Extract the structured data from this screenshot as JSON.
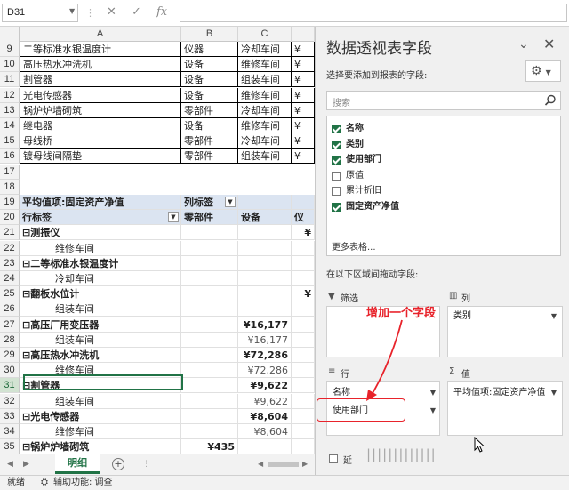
{
  "formula_bar": {
    "name_box": "D31",
    "icons": [
      "cancel-x-icon",
      "enter-check-icon",
      "fx-icon"
    ],
    "fx_label": "fx",
    "formula": ""
  },
  "sheet": {
    "columns": [
      "A",
      "B",
      "C"
    ],
    "selected_cell": "D31",
    "source_rows": [
      {
        "row": "9",
        "a": "二等标准水银温度计",
        "b": "仪器",
        "c": "冷却车间",
        "d": "¥"
      },
      {
        "row": "10",
        "a": "高压热水冲洗机",
        "b": "设备",
        "c": "维修车间",
        "d": "¥"
      },
      {
        "row": "11",
        "a": "割管器",
        "b": "设备",
        "c": "组装车间",
        "d": "¥"
      },
      {
        "row": "12",
        "a": "光电传感器",
        "b": "设备",
        "c": "维修车间",
        "d": "¥"
      },
      {
        "row": "13",
        "a": "锅炉炉墙砌筑",
        "b": "零部件",
        "c": "冷却车间",
        "d": "¥"
      },
      {
        "row": "14",
        "a": "继电器",
        "b": "设备",
        "c": "维修车间",
        "d": "¥"
      },
      {
        "row": "15",
        "a": "母线桥",
        "b": "零部件",
        "c": "冷却车间",
        "d": "¥"
      },
      {
        "row": "16",
        "a": "镀母线间隔垫",
        "b": "零部件",
        "c": "组装车间",
        "d": "¥"
      }
    ],
    "blank_rows": [
      "17",
      "18"
    ],
    "pivot_header": {
      "row": "19",
      "a": "平均值项:固定资产净值",
      "b": "列标签"
    },
    "pivot_col_header": {
      "row": "20",
      "a": "行标签",
      "b": "零部件",
      "c": "设备",
      "d": "仪"
    },
    "pivot_rows": [
      {
        "row": "21",
        "a": "⊟测振仪",
        "b": "",
        "c": "",
        "d": "¥",
        "level": 1
      },
      {
        "row": "22",
        "a": "维修车间",
        "b": "",
        "c": "",
        "d": "",
        "level": 2
      },
      {
        "row": "23",
        "a": "⊟二等标准水银温度计",
        "b": "",
        "c": "",
        "d": "",
        "level": 1
      },
      {
        "row": "24",
        "a": "冷却车间",
        "b": "",
        "c": "",
        "d": "",
        "level": 2
      },
      {
        "row": "25",
        "a": "⊟翻板水位计",
        "b": "",
        "c": "",
        "d": "¥",
        "level": 1
      },
      {
        "row": "26",
        "a": "组装车间",
        "b": "",
        "c": "",
        "d": "",
        "level": 2
      },
      {
        "row": "27",
        "a": "⊟高压厂用变压器",
        "b": "",
        "c": "¥16,177",
        "d": "",
        "level": 1
      },
      {
        "row": "28",
        "a": "组装车间",
        "b": "",
        "c": "¥16,177",
        "d": "",
        "level": 2
      },
      {
        "row": "29",
        "a": "⊟高压热水冲洗机",
        "b": "",
        "c": "¥72,286",
        "d": "",
        "level": 1
      },
      {
        "row": "30",
        "a": "维修车间",
        "b": "",
        "c": "¥72,286",
        "d": "",
        "level": 2
      },
      {
        "row": "31",
        "a": "⊟割管器",
        "b": "",
        "c": "¥9,622",
        "d": "",
        "level": 1
      },
      {
        "row": "32",
        "a": "组装车间",
        "b": "",
        "c": "¥9,622",
        "d": "",
        "level": 2
      },
      {
        "row": "33",
        "a": "⊟光电传感器",
        "b": "",
        "c": "¥8,604",
        "d": "",
        "level": 1
      },
      {
        "row": "34",
        "a": "维修车间",
        "b": "",
        "c": "¥8,604",
        "d": "",
        "level": 2
      },
      {
        "row": "35",
        "a": "⊟锅炉炉墙砌筑",
        "b": "¥435",
        "c": "",
        "d": "",
        "level": 1
      },
      {
        "row": "36",
        "a": "",
        "b": "",
        "c": "",
        "d": "",
        "level": 2
      }
    ]
  },
  "tabs": {
    "sheet_name": "明细"
  },
  "status": {
    "ready": "就绪",
    "accessibility": "辅助功能: 调查"
  },
  "pane": {
    "title": "数据透视表字段",
    "subtitle": "选择要添加到报表的字段:",
    "search_placeholder": "搜索",
    "fields": [
      {
        "label": "名称",
        "checked": true
      },
      {
        "label": "类别",
        "checked": true
      },
      {
        "label": "使用部门",
        "checked": true
      },
      {
        "label": "原值",
        "checked": false
      },
      {
        "label": "累计折旧",
        "checked": false
      },
      {
        "label": "固定资产净值",
        "checked": true
      }
    ],
    "more_tables": "更多表格...",
    "drag_hint": "在以下区域间拖动字段:",
    "areas": {
      "filter": {
        "label": "筛选",
        "items": []
      },
      "columns": {
        "label": "列",
        "items": [
          "类别"
        ]
      },
      "rows": {
        "label": "行",
        "items": [
          "名称",
          "使用部门"
        ]
      },
      "values": {
        "label": "值",
        "items": [
          "平均值项:固定资产净值"
        ]
      }
    },
    "defer_label": "延"
  },
  "annotation": {
    "text": "增加一个字段",
    "color": "#e8232b"
  },
  "watermark": "|||||||||||||",
  "colors": {
    "accent": "#217346",
    "pivot_header": "#dbe4f1",
    "annotation": "#e8232b"
  }
}
